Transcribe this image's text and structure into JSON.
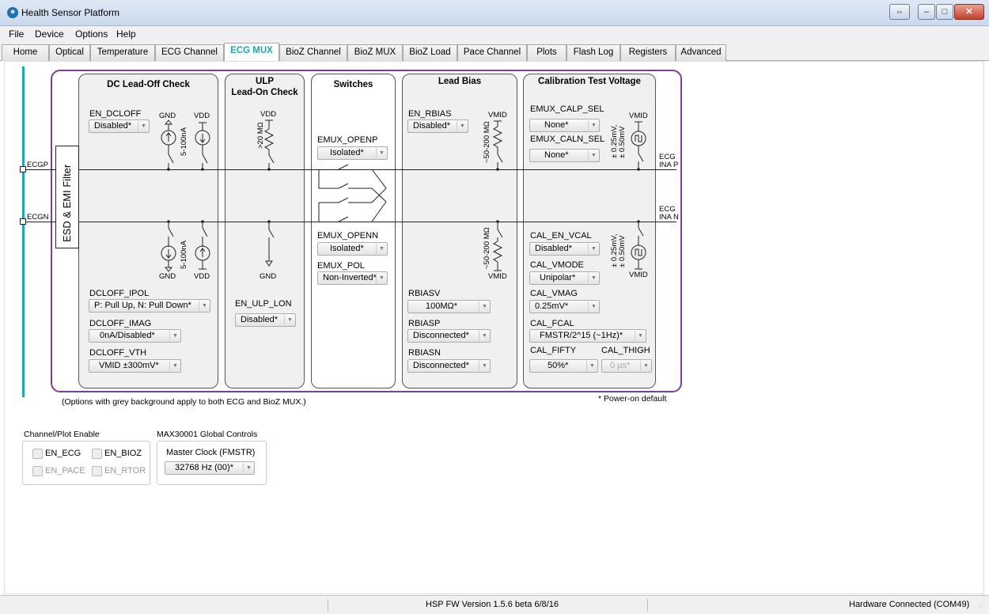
{
  "window": {
    "title": "Health Sensor Platform",
    "controls": [
      "⇔",
      "–",
      "□",
      "✕"
    ]
  },
  "menu": [
    "File",
    "Device",
    "Options",
    "Help"
  ],
  "tabs": [
    "Home",
    "Optical",
    "Temperature",
    "ECG Channel",
    "ECG MUX",
    "BioZ Channel",
    "BioZ MUX",
    "BioZ Load",
    "Pace Channel",
    "Plots",
    "Flash Log",
    "Registers",
    "Advanced"
  ],
  "active_tab": "ECG MUX",
  "filter_label": "ESD & EMI Filter",
  "inputs": {
    "ecgp": "ECGP",
    "ecgn": "ECGN"
  },
  "outputs": {
    "inap_1": "ECG",
    "inap_2": "INA P",
    "inan_1": "ECG",
    "inan_2": "INA N"
  },
  "dc": {
    "title": "DC Lead-Off Check",
    "en_label": "EN_DCLOFF",
    "en_value": "Disabled*",
    "gnd_top": "GND",
    "vdd_top": "VDD",
    "current_top": "5-100nA",
    "gnd_bot": "GND",
    "vdd_bot": "VDD",
    "current_bot": "5-100nA",
    "ipol_label": "DCLOFF_IPOL",
    "ipol_value": "P: Pull Up, N: Pull Down*",
    "imag_label": "DCLOFF_IMAG",
    "imag_value": "0nA/Disabled*",
    "vth_label": "DCLOFF_VTH",
    "vth_value": "VMID ±300mV*"
  },
  "ulp": {
    "title1": "ULP",
    "title2": "Lead-On Check",
    "vdd": "VDD",
    "res": ">20 MΩ",
    "gnd": "GND",
    "lon_label": "EN_ULP_LON",
    "lon_value": "Disabled*"
  },
  "switches": {
    "title": "Switches",
    "openp_label": "EMUX_OPENP",
    "openp_value": "Isolated*",
    "openn_label": "EMUX_OPENN",
    "openn_value": "Isolated*",
    "pol_label": "EMUX_POL",
    "pol_value": "Non-Inverted*"
  },
  "bias": {
    "title": "Lead Bias",
    "en_label": "EN_RBIAS",
    "en_value": "Disabled*",
    "vmid_top": "VMID",
    "res_top": "~50-200 MΩ",
    "vmid_bot": "VMID",
    "res_bot": "~50-200 MΩ",
    "rbiasv_label": "RBIASV",
    "rbiasv_value": "100MΩ*",
    "rbiasp_label": "RBIASP",
    "rbiasp_value": "Disconnected*",
    "rbiasn_label": "RBIASN",
    "rbiasn_value": "Disconnected*"
  },
  "cal": {
    "title": "Calibration Test Voltage",
    "calp_label": "EMUX_CALP_SEL",
    "calp_value": "None*",
    "caln_label": "EMUX_CALN_SEL",
    "caln_value": "None*",
    "vmid_top": "VMID",
    "amp_top": "± 0.25mV,\n± 0.50mV",
    "en_label": "CAL_EN_VCAL",
    "en_value": "Disabled*",
    "mode_label": "CAL_VMODE",
    "mode_value": "Unipolar*",
    "vmid_bot": "VMID",
    "amp_bot": "± 0.25mV,\n± 0.50mV",
    "vmag_label": "CAL_VMAG",
    "vmag_value": "0.25mV*",
    "fcal_label": "CAL_FCAL",
    "fcal_value": "FMSTR/2^15 (~1Hz)*",
    "fifty_label": "CAL_FIFTY",
    "fifty_value": "50%*",
    "thigh_label": "CAL_THIGH",
    "thigh_value": "0 µs*"
  },
  "note_left": "(Options with grey background apply to both ECG and BioZ MUX.)",
  "note_right": "* Power-on default",
  "channel_enable": {
    "title": "Channel/Plot Enable",
    "ecg": "EN_ECG",
    "bioz": "EN_BIOZ",
    "pace": "EN_PACE",
    "rtor": "EN_RTOR"
  },
  "global": {
    "title": "MAX30001 Global Controls",
    "clock_label": "Master Clock (FMSTR)",
    "clock_value": "32768 Hz (00)*"
  },
  "status": {
    "version": "HSP FW Version 1.5.6 beta 6/8/16",
    "connection": "Hardware Connected (COM49)"
  },
  "colors": {
    "accent": "#1aa9b5",
    "frame": "#7a3fa0"
  }
}
